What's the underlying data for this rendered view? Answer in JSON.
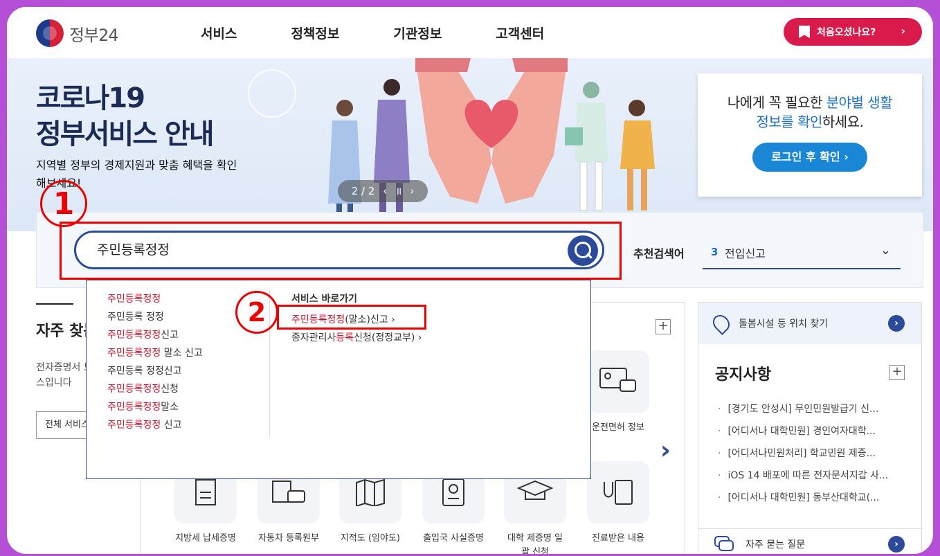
{
  "header": {
    "logo_text": "정부24",
    "nav": [
      "서비스",
      "정책정보",
      "기관정보",
      "고객센터"
    ],
    "first_visit_label": "처음오셨나요?"
  },
  "banner": {
    "title_line1": "코로나19",
    "title_line2": "정부서비스 안내",
    "subtitle": "지역별 정부의 경제지원과 맞춤 혜택을 확인해보세요!",
    "pager": "2 / 2",
    "login_msg_1": "나에게 꼭 필요한 ",
    "login_msg_hl1": "분야별 생활",
    "login_msg_hl2": "정보를 확인",
    "login_msg_2": "하세요.",
    "login_button": "로그인 후 확인 ›"
  },
  "search": {
    "value": "주민등록정정",
    "recommend_label": "추천검색어",
    "recommend_num": "3",
    "recommend_word": "전입신고"
  },
  "annotations": {
    "one": "1",
    "two": "2"
  },
  "dropdown": {
    "suggestions": [
      {
        "hl": "주민등록정정",
        "rest": ""
      },
      {
        "hl": "",
        "rest": "주민등록 정정"
      },
      {
        "hl": "주민등록정정",
        "rest": "신고"
      },
      {
        "hl": "주민등록정정",
        "rest": " 말소 신고"
      },
      {
        "hl": "",
        "rest": "주민등록 정정신고"
      },
      {
        "hl": "주민등록정정",
        "rest": "신청"
      },
      {
        "hl": "주민등록정정",
        "rest": "말소"
      },
      {
        "hl": "주민등록정정",
        "rest": " 신고"
      }
    ],
    "shortcut_head": "서비스 바로가기",
    "shortcut_1_hl": "주민등록정정",
    "shortcut_1_rest": "(말소)신고 ›",
    "shortcut_2_a": "종자관리사",
    "shortcut_2_hl": "등록",
    "shortcut_2_b": "신청(정정교부) ›"
  },
  "frequent": {
    "title": "자주 찾는 서비스",
    "desc": "전자증명서 모바일 앱 서비스입니다",
    "all_button": "전체 서비스"
  },
  "services": [
    {
      "label": "운전면허 정보",
      "icon": "license-icon"
    },
    {
      "label": "지방세 납세증명",
      "icon": "document-icon"
    },
    {
      "label": "자동차 등록원부",
      "icon": "car-icon"
    },
    {
      "label": "지적도 (임야도)",
      "icon": "map-icon"
    },
    {
      "label": "출입국 사실증명",
      "icon": "passport-icon"
    },
    {
      "label": "대학 제증명 일괄 신청",
      "icon": "graduation-cap-icon"
    },
    {
      "label": "진료받은 내용",
      "icon": "stethoscope-icon"
    }
  ],
  "right": {
    "care_finder": "돌봄시설 등 위치 찾기",
    "notice_title": "공지사항",
    "notices": [
      "[경기도 안성시] 무인민원발급기 신...",
      "[어디서나 대학민원] 경인여자대학...",
      "[어디서나민원처리] 학교민원 제증...",
      "iOS 14 배포에 따른 전자문서지갑 사...",
      "[어디서나 대학민원] 동부산대학교(..."
    ],
    "faq": "자주 묻는 질문"
  },
  "colors": {
    "accent": "#2c4a9a",
    "brand_red": "#d91a4a",
    "annotation": "#e00000",
    "highlight": "#d0112b"
  }
}
